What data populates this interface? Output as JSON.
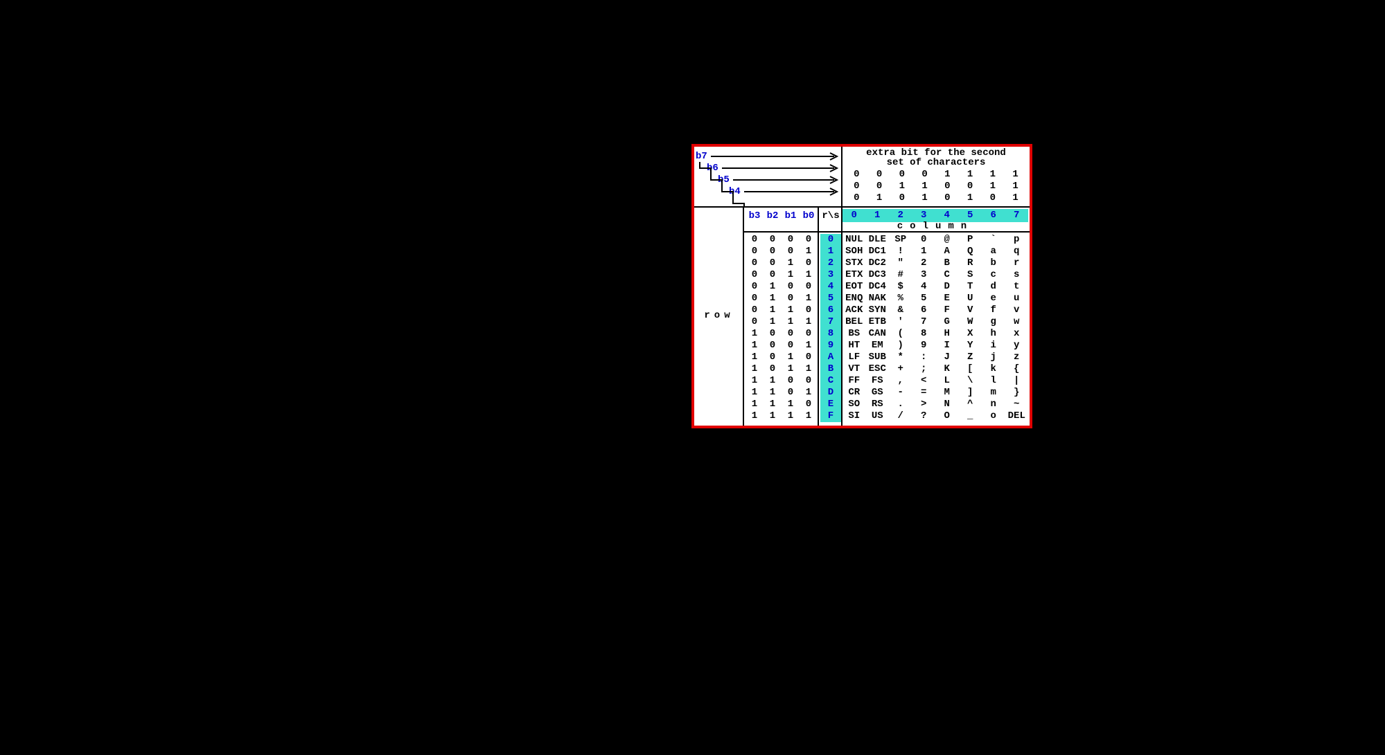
{
  "header_title_line1": "extra bit for the second",
  "header_title_line2": "set of characters",
  "bit_labels_high": [
    "b7",
    "b6",
    "b5",
    "b4"
  ],
  "bit_values_b7": [
    "0",
    "0",
    "0",
    "0",
    "1",
    "1",
    "1",
    "1"
  ],
  "bit_values_b6": [
    "0",
    "0",
    "1",
    "1",
    "0",
    "0",
    "1",
    "1"
  ],
  "bit_values_b5": [
    "0",
    "1",
    "0",
    "1",
    "0",
    "1",
    "0",
    "1"
  ],
  "bits_header": [
    "b3",
    "b2",
    "b1",
    "b0"
  ],
  "rs_label": "r\\s",
  "column_numbers": [
    "0",
    "1",
    "2",
    "3",
    "4",
    "5",
    "6",
    "7"
  ],
  "column_word": "column",
  "row_word": "row",
  "rows": [
    {
      "bits": [
        "0",
        "0",
        "0",
        "0"
      ],
      "hex": "0",
      "vals": [
        "NUL",
        "DLE",
        "SP",
        "0",
        "@",
        "P",
        "`",
        "p"
      ]
    },
    {
      "bits": [
        "0",
        "0",
        "0",
        "1"
      ],
      "hex": "1",
      "vals": [
        "SOH",
        "DC1",
        "!",
        "1",
        "A",
        "Q",
        "a",
        "q"
      ]
    },
    {
      "bits": [
        "0",
        "0",
        "1",
        "0"
      ],
      "hex": "2",
      "vals": [
        "STX",
        "DC2",
        "\"",
        "2",
        "B",
        "R",
        "b",
        "r"
      ]
    },
    {
      "bits": [
        "0",
        "0",
        "1",
        "1"
      ],
      "hex": "3",
      "vals": [
        "ETX",
        "DC3",
        "#",
        "3",
        "C",
        "S",
        "c",
        "s"
      ]
    },
    {
      "bits": [
        "0",
        "1",
        "0",
        "0"
      ],
      "hex": "4",
      "vals": [
        "EOT",
        "DC4",
        "$",
        "4",
        "D",
        "T",
        "d",
        "t"
      ]
    },
    {
      "bits": [
        "0",
        "1",
        "0",
        "1"
      ],
      "hex": "5",
      "vals": [
        "ENQ",
        "NAK",
        "%",
        "5",
        "E",
        "U",
        "e",
        "u"
      ]
    },
    {
      "bits": [
        "0",
        "1",
        "1",
        "0"
      ],
      "hex": "6",
      "vals": [
        "ACK",
        "SYN",
        "&",
        "6",
        "F",
        "V",
        "f",
        "v"
      ]
    },
    {
      "bits": [
        "0",
        "1",
        "1",
        "1"
      ],
      "hex": "7",
      "vals": [
        "BEL",
        "ETB",
        "'",
        "7",
        "G",
        "W",
        "g",
        "w"
      ]
    },
    {
      "bits": [
        "1",
        "0",
        "0",
        "0"
      ],
      "hex": "8",
      "vals": [
        "BS",
        "CAN",
        "(",
        "8",
        "H",
        "X",
        "h",
        "x"
      ]
    },
    {
      "bits": [
        "1",
        "0",
        "0",
        "1"
      ],
      "hex": "9",
      "vals": [
        "HT",
        "EM",
        ")",
        "9",
        "I",
        "Y",
        "i",
        "y"
      ]
    },
    {
      "bits": [
        "1",
        "0",
        "1",
        "0"
      ],
      "hex": "A",
      "vals": [
        "LF",
        "SUB",
        "*",
        ":",
        "J",
        "Z",
        "j",
        "z"
      ]
    },
    {
      "bits": [
        "1",
        "0",
        "1",
        "1"
      ],
      "hex": "B",
      "vals": [
        "VT",
        "ESC",
        "+",
        ";",
        "K",
        "[",
        "k",
        "{"
      ]
    },
    {
      "bits": [
        "1",
        "1",
        "0",
        "0"
      ],
      "hex": "C",
      "vals": [
        "FF",
        "FS",
        ",",
        "<",
        "L",
        "\\",
        "l",
        "|"
      ]
    },
    {
      "bits": [
        "1",
        "1",
        "0",
        "1"
      ],
      "hex": "D",
      "vals": [
        "CR",
        "GS",
        "-",
        "=",
        "M",
        "]",
        "m",
        "}"
      ]
    },
    {
      "bits": [
        "1",
        "1",
        "1",
        "0"
      ],
      "hex": "E",
      "vals": [
        "SO",
        "RS",
        ".",
        ">",
        "N",
        "^",
        "n",
        "~"
      ]
    },
    {
      "bits": [
        "1",
        "1",
        "1",
        "1"
      ],
      "hex": "F",
      "vals": [
        "SI",
        "US",
        "/",
        "?",
        "O",
        "_",
        "o",
        "DEL"
      ]
    }
  ]
}
